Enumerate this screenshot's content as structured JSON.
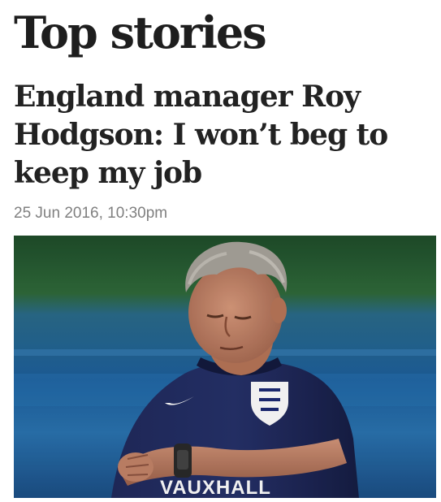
{
  "section": {
    "title": "Top stories"
  },
  "story": {
    "headline": "England manager Roy Hodgson: I won’t beg to keep my job",
    "timestamp": "25 Jun 2016, 10:30pm",
    "image": {
      "shirt_sponsor_text": "VAUXHALL",
      "colors": {
        "background_green": "#2f6a3a",
        "background_blue": "#1d5f9c",
        "shirt_navy": "#1c2452",
        "hair_grey": "#a8a49c",
        "skin": "#c98b6e",
        "watch": "#2a2a2a"
      }
    }
  }
}
